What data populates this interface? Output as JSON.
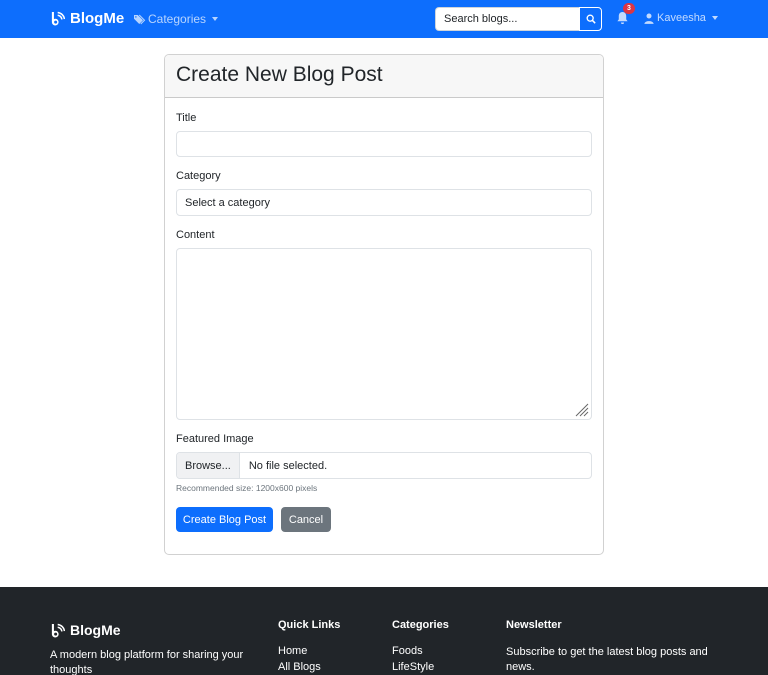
{
  "navbar": {
    "brand": "BlogMe",
    "categories_label": "Categories",
    "search_placeholder": "Search blogs...",
    "notification_count": "3",
    "username": "Kaveesha"
  },
  "form": {
    "heading": "Create New Blog Post",
    "title_label": "Title",
    "title_value": "",
    "category_label": "Category",
    "category_selected": "Select a category",
    "content_label": "Content",
    "content_value": "",
    "image_label": "Featured Image",
    "browse_label": "Browse...",
    "file_status": "No file selected.",
    "image_hint": "Recommended size: 1200x600 pixels",
    "submit_label": "Create Blog Post",
    "cancel_label": "Cancel"
  },
  "footer": {
    "brand": "BlogMe",
    "description": "A modern blog platform for sharing your thoughts",
    "quick_links_heading": "Quick Links",
    "quick_links": [
      "Home",
      "All Blogs"
    ],
    "categories_heading": "Categories",
    "categories": [
      "Foods",
      "LifeStyle"
    ],
    "newsletter_heading": "Newsletter",
    "newsletter_text": "Subscribe to get the latest blog posts and news."
  },
  "colors": {
    "primary": "#0d6efd",
    "secondary": "#6c757d",
    "danger": "#dc3545",
    "footer_bg": "#212529"
  },
  "icons": [
    "blog-logo-icon",
    "tag-icon",
    "search-icon",
    "bell-icon",
    "user-icon",
    "resize-grip-icon"
  ]
}
